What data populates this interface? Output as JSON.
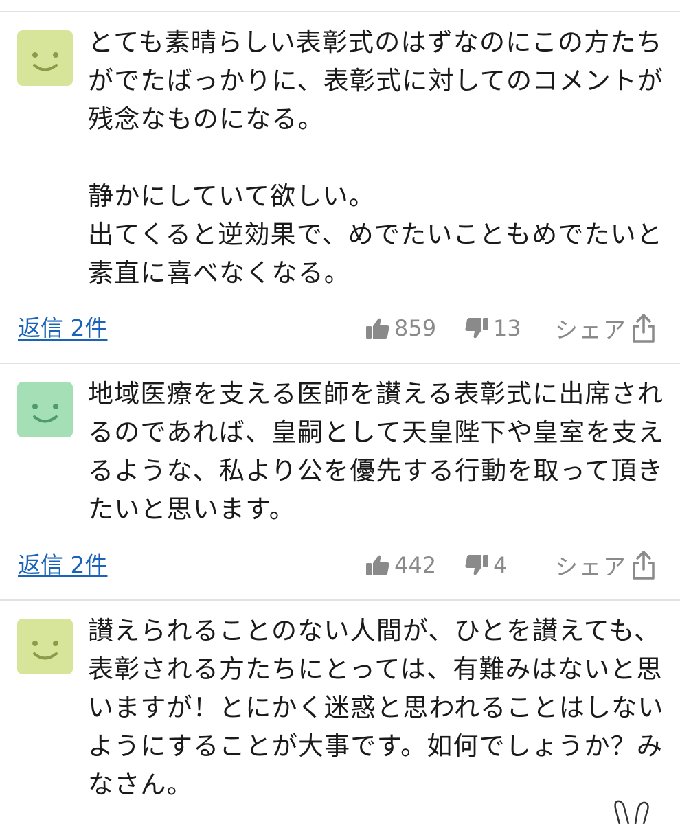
{
  "colors": {
    "avatar_yellow_green": "#d6e59a",
    "avatar_mint": "#a5dfb6",
    "face": "#8c9a4a",
    "face_mint": "#4f9b6b",
    "link": "#1a63b8",
    "muted": "#8a8a8a",
    "divider": "#e2e2e2"
  },
  "comments": [
    {
      "avatar_icon": "smiley-face-icon",
      "lines": [
        "とても素晴らしい表彰式のはずなのにこの方たち",
        "がでたばっかりに、表彰式に対してのコメントが",
        "残念なものになる。",
        "",
        "静かにしていて欲しい。",
        "出てくると逆効果で、めでたいこともめでたいと",
        "素直に喜べなくなる。"
      ],
      "reply_label": "返信 2件",
      "likes": "859",
      "dislikes": "13",
      "share_label": "シェア"
    },
    {
      "avatar_icon": "smiley-face-icon",
      "lines": [
        "地域医療を支える医師を讃える表彰式に出席され",
        "るのであれば、皇嗣として天皇陛下や皇室を支え",
        "るような、私より公を優先する行動を取って頂き",
        "たいと思います。"
      ],
      "reply_label": "返信 2件",
      "likes": "442",
      "dislikes": "4",
      "share_label": "シェア"
    },
    {
      "avatar_icon": "smiley-face-icon",
      "lines": [
        "讃えられることのない人間が、ひとを讃えても、",
        "表彰される方たちにとっては、有難みはないと思",
        "いますが！とにかく迷惑と思われることはしない",
        "ようにすることが大事です。如何でしょうか？み",
        "なさん。"
      ]
    }
  ]
}
